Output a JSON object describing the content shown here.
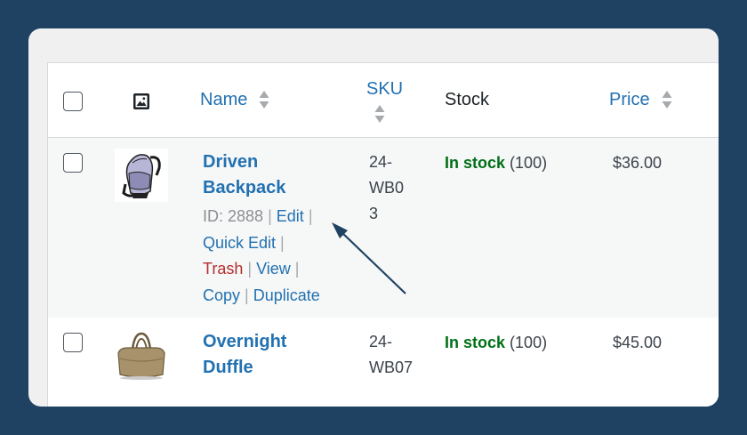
{
  "header": {
    "name_label": "Name",
    "sku_label": "SKU",
    "stock_label": "Stock",
    "price_label": "Price"
  },
  "products": [
    {
      "name_line1": "Driven",
      "name_line2": "Backpack",
      "id_text": "ID: 2888",
      "edit": "Edit",
      "quick_edit": "Quick Edit",
      "trash": "Trash",
      "view": "View",
      "copy": "Copy",
      "duplicate": "Duplicate",
      "sku_lines": [
        "24-",
        "WB0",
        "3"
      ],
      "stock_status": "In stock",
      "stock_count": "(100)",
      "price": "$36.00"
    },
    {
      "name_line1": "Overnight",
      "name_line2": "Duffle",
      "sku_lines": [
        "24-",
        "WB07"
      ],
      "stock_status": "In stock",
      "stock_count": "(100)",
      "price": "$45.00"
    }
  ],
  "separator": "|",
  "colors": {
    "background": "#1f4263",
    "link": "#2271b1",
    "trash": "#b32d2e",
    "in_stock": "#007017",
    "muted": "#8c8f94",
    "arrow": "#1f4263"
  }
}
